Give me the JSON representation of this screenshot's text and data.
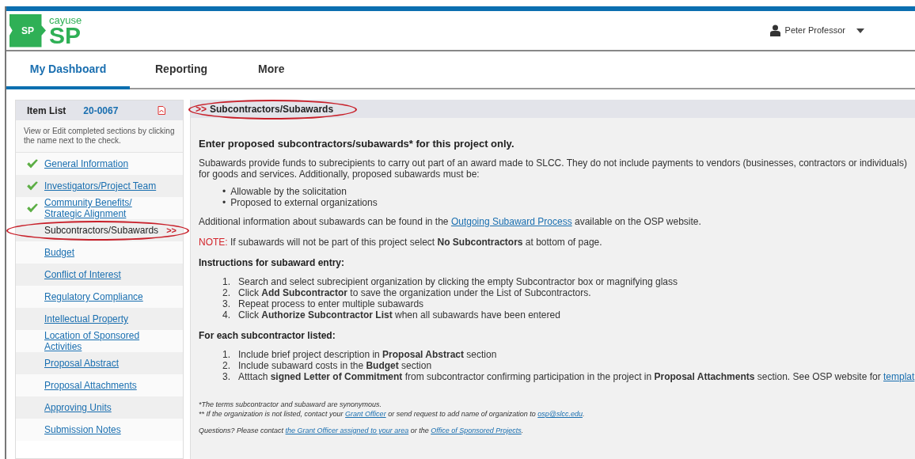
{
  "header": {
    "logo": {
      "badge": "SP",
      "brand": "cayuse",
      "product": "SP"
    },
    "user": {
      "name": "Peter Professor"
    }
  },
  "tabs": [
    {
      "label": "My Dashboard",
      "selected": true
    },
    {
      "label": "Reporting",
      "selected": false
    },
    {
      "label": "More",
      "selected": false
    }
  ],
  "sidebar": {
    "title": "Item List",
    "number": "20-0067",
    "description": "View or Edit completed sections by clicking the name next to the check.",
    "items": [
      {
        "label": "General Information",
        "done": true,
        "current": false
      },
      {
        "label": "Investigators/Project Team",
        "done": true,
        "current": false
      },
      {
        "label": "Community Benefits/ Strategic Alignment",
        "done": true,
        "current": false
      },
      {
        "label": "Subcontractors/Subawards",
        "done": false,
        "current": true,
        "marker": ">>",
        "highlighted": true
      },
      {
        "label": "Budget",
        "done": false,
        "current": false
      },
      {
        "label": "Conflict of Interest",
        "done": false,
        "current": false
      },
      {
        "label": "Regulatory Compliance",
        "done": false,
        "current": false
      },
      {
        "label": "Intellectual Property",
        "done": false,
        "current": false
      },
      {
        "label": "Location of Sponsored Activities",
        "done": false,
        "current": false
      },
      {
        "label": "Proposal Abstract",
        "done": false,
        "current": false
      },
      {
        "label": "Proposal Attachments",
        "done": false,
        "current": false
      },
      {
        "label": "Approving Units",
        "done": false,
        "current": false
      },
      {
        "label": "Submission Notes",
        "done": false,
        "current": false
      }
    ]
  },
  "section": {
    "marker": ">>",
    "title": "Subcontractors/Subawards",
    "highlighted": true
  },
  "content": {
    "heading": "Enter proposed subcontractors/subawards* for this project only.",
    "intro": "Subawards provide funds to subrecipients to carry out part of an award made to SLCC. They do not include payments to vendors (businesses, contractors or individuals) for goods and services. Additionally, proposed subawards must be:",
    "bullets": [
      {
        "bullet": "•",
        "text": "Allowable by the solicitation"
      },
      {
        "bullet": "•",
        "text": "Proposed to external organizations"
      }
    ],
    "info": [
      {
        "kind": "text",
        "text": "Additional information about subawards can be found in the "
      },
      {
        "kind": "link",
        "text": "Outgoing Subaward Process"
      },
      {
        "kind": "text",
        "text": " available on the OSP website."
      }
    ],
    "note": {
      "label": "NOTE:",
      "text": "If subawards will not be part of this project select **No Subcontractors** at bottom of page."
    },
    "instructions_title": "Instructions for subaward entry:",
    "instructions": [
      {
        "number": "1.",
        "text": "Search and select subrecipient organization by clicking the empty Subcontractor box or magnifying glass"
      },
      {
        "number": "2.",
        "text": "Click **Add Subcontractor** to save the organization under the List of Subcontractors."
      },
      {
        "number": "3.",
        "text": "Repeat process to enter multiple subawards"
      },
      {
        "number": "4.",
        "text": "Click **Authorize Subcontractor List** when all subawards have been entered"
      }
    ],
    "each_title": "For each subcontractor listed:",
    "each": [
      {
        "number": "1.",
        "segments": [
          {
            "kind": "text",
            "text": "Include brief project description in **Proposal Abstract** section"
          }
        ]
      },
      {
        "number": "2.",
        "segments": [
          {
            "kind": "text",
            "text": "Include subaward costs in the **Budget** section"
          }
        ]
      },
      {
        "number": "3.",
        "segments": [
          {
            "kind": "text",
            "text": "Atttach **signed Letter of Commitment** from subcontractor confirming participation in the project in **Proposal Attachments** section. See OSP website for "
          },
          {
            "kind": "link",
            "text": "templat"
          }
        ]
      }
    ],
    "footnotes": [
      [
        {
          "kind": "text",
          "text": "*The terms subcontractor and subaward are synonymous."
        }
      ],
      [
        {
          "kind": "text",
          "text": "** If the organization is not listed, contact your "
        },
        {
          "kind": "link",
          "text": "Grant Officer"
        },
        {
          "kind": "text",
          "text": " or send request to add name of organization to "
        },
        {
          "kind": "link",
          "text": "osp@slcc.edu"
        },
        {
          "kind": "text",
          "text": "."
        }
      ]
    ],
    "questions": [
      {
        "kind": "text",
        "text": "Questions? Please contact "
      },
      {
        "kind": "link",
        "text": "the Grant Officer assigned to your area"
      },
      {
        "kind": "text",
        "text": " or the "
      },
      {
        "kind": "link",
        "text": "Office of Sponsored Projects"
      },
      {
        "kind": "text",
        "text": "."
      }
    ]
  }
}
